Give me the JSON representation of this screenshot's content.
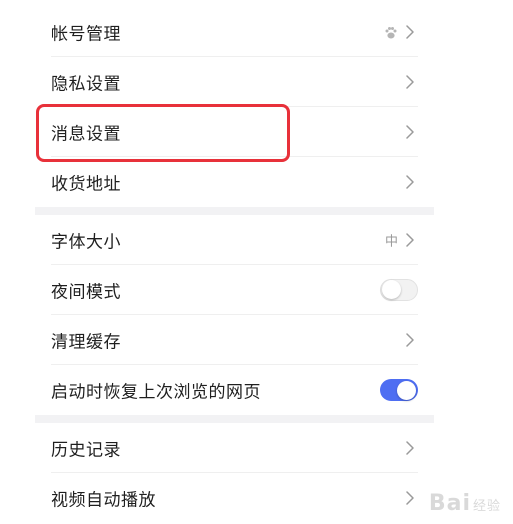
{
  "settings": {
    "group1": [
      {
        "label": "帐号管理",
        "accessory": "paw-chevron"
      },
      {
        "label": "隐私设置",
        "accessory": "chevron"
      },
      {
        "label": "消息设置",
        "accessory": "chevron"
      },
      {
        "label": "收货地址",
        "accessory": "chevron"
      }
    ],
    "group2": [
      {
        "label": "字体大小",
        "value": "中",
        "accessory": "value-chevron"
      },
      {
        "label": "夜间模式",
        "toggle": "off"
      },
      {
        "label": "清理缓存",
        "accessory": "chevron"
      },
      {
        "label": "启动时恢复上次浏览的网页",
        "toggle": "on"
      }
    ],
    "group3": [
      {
        "label": "历史记录",
        "accessory": "chevron"
      },
      {
        "label": "视频自动播放",
        "accessory": "chevron"
      }
    ]
  },
  "highlight": {
    "target": "消息设置",
    "color": "#e8313a"
  },
  "toggle_on_color": "#4e6ef2",
  "icons": {
    "chevron": "chevron-right-icon",
    "paw": "baidu-paw-icon"
  },
  "watermark": {
    "text": "Bai",
    "sub": "经验"
  }
}
